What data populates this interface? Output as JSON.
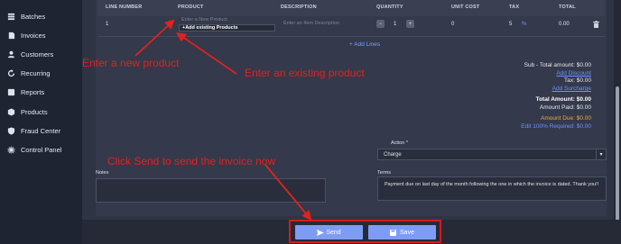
{
  "sidebar": {
    "items": [
      {
        "label": "Batches",
        "icon": "batches-icon"
      },
      {
        "label": "Invoices",
        "icon": "invoices-icon"
      },
      {
        "label": "Customers",
        "icon": "customers-icon"
      },
      {
        "label": "Recurring",
        "icon": "recurring-icon"
      },
      {
        "label": "Reports",
        "icon": "reports-icon"
      },
      {
        "label": "Products",
        "icon": "products-icon"
      },
      {
        "label": "Fraud Center",
        "icon": "fraud-center-icon"
      },
      {
        "label": "Control Panel",
        "icon": "control-panel-icon"
      }
    ]
  },
  "table": {
    "headers": {
      "line_number": "LINE NUMBER",
      "product": "PRODUCT",
      "description": "DESCRIPTION",
      "quantity": "QUANTITY",
      "unit_cost": "UNIT COST",
      "tax": "TAX",
      "total": "TOTAL"
    },
    "row": {
      "line_number": "1",
      "product_placeholder": "Enter a New Product",
      "product_option": "+Add existing Products",
      "description_placeholder": "Enter an Item Description",
      "quantity": "1",
      "qty_minus": "−",
      "qty_plus": "+",
      "unit_cost": "0",
      "tax": "5",
      "tax_unit": "%",
      "total": "0.00"
    },
    "add_lines": "+ Add Lines"
  },
  "totals": {
    "subtotal": "Sub - Total amount: $0.00",
    "add_discount": "Add Discount",
    "tax": "Tax: $0.00",
    "add_surcharge": "Add Surcharge",
    "total_amount": "Total Amount: $0.00",
    "amount_paid": "Amount Paid: $0.00",
    "amount_due": "Amount Due: $0.00",
    "edit_required": "Edit 100% Required: $0.00"
  },
  "action": {
    "label": "Action *",
    "value": "Charge"
  },
  "notes": {
    "label": "Notes",
    "value": ""
  },
  "terms": {
    "label": "Terms",
    "value": "Payment due on last day of the month following the one in which the invoice is dated. Thank you!!"
  },
  "buttons": {
    "send": "Send",
    "save": "Save"
  },
  "annotations": {
    "new_product": "Enter a new product",
    "existing_product": "Enter an existing product",
    "send_tip": "Click Send to send the invoice now"
  },
  "colors": {
    "annotation": "#e0221f",
    "button": "#7f9cf5",
    "link": "#6f93ff",
    "amount_due": "#f2a93b"
  }
}
